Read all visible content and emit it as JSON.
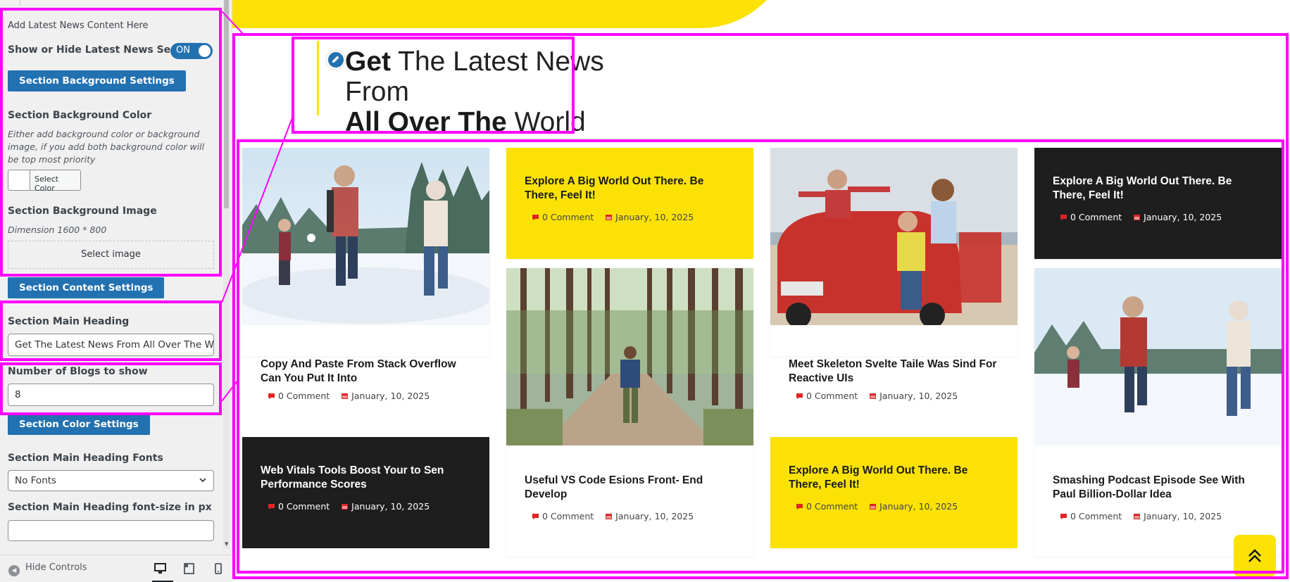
{
  "colors": {
    "accent_yellow": "#fbe204",
    "dark_card": "#1e1e1e",
    "wp_blue": "#2271b1",
    "highlight": "#ff00ff",
    "meta_red": "#e02424"
  },
  "sidebar": {
    "section_title": "Add Latest News Content Here",
    "show_hide_label": "Show or Hide Latest News Section",
    "toggle_state": "ON",
    "bg_settings_button": "Section Background Settings",
    "bg_color_label": "Section Background Color",
    "bg_color_desc": "Either add background color or background image, if you add both background color will be top most priority",
    "select_color": "Select Color",
    "bg_image_label": "Section Background Image",
    "bg_image_dimension": "Dimension 1600 * 800",
    "select_image": "Select image",
    "content_settings_button": "Section Content Settings",
    "main_heading_label": "Section Main Heading",
    "main_heading_value": "Get The Latest News From All Over The World",
    "blogs_count_label": "Number of Blogs to show",
    "blogs_count_value": "8",
    "color_settings_button": "Section Color Settings",
    "heading_fonts_label": "Section Main Heading Fonts",
    "heading_fonts_value": "No Fonts",
    "heading_font_size_label": "Section Main Heading font-size in px",
    "heading_font_size_value": "",
    "hide_controls": "Hide Controls",
    "devices": [
      "desktop-icon",
      "tablet-icon",
      "mobile-icon"
    ]
  },
  "preview": {
    "heading_line1_bold": "Get",
    "heading_line1_rest": " The Latest News From",
    "heading_line2_bold": "All Over The",
    "heading_line2_rest": " World",
    "cards": [
      {
        "style": "photo-white",
        "image": "winter-friends-photo",
        "title": "Copy And Paste From Stack Overflow Can You Put It Into",
        "comments": "0 Comment",
        "date": "January, 10, 2025"
      },
      {
        "style": "yellow",
        "title": "Explore A Big World Out There. Be There, Feel It!",
        "comments": "0 Comment",
        "date": "January, 10, 2025"
      },
      {
        "style": "photo-white",
        "image": "friends-red-car-photo",
        "title": "Meet Skeleton Svelte Taile Was Sind For Reactive UIs",
        "comments": "0 Comment",
        "date": "January, 10, 2025"
      },
      {
        "style": "dark",
        "title": "Explore A Big World Out There. Be There, Feel It!",
        "comments": "0 Comment",
        "date": "January, 10, 2025"
      },
      {
        "style": "dark",
        "title": "Web Vitals Tools Boost Your to Sen Performance Scores",
        "comments": "0 Comment",
        "date": "January, 10, 2025"
      },
      {
        "style": "photo-white",
        "image": "forest-hiker-photo",
        "title": "Useful VS Code Esions Front- End Develop",
        "comments": "0 Comment",
        "date": "January, 10, 2025"
      },
      {
        "style": "yellow",
        "title": "Explore A Big World Out There. Be There, Feel It!",
        "comments": "0 Comment",
        "date": "January, 10, 2025"
      },
      {
        "style": "photo-white",
        "image": "winter-friends-photo",
        "title": "Smashing Podcast Episode See With Paul Billion-Dollar Idea",
        "comments": "0 Comment",
        "date": "January, 10, 2025"
      }
    ]
  }
}
